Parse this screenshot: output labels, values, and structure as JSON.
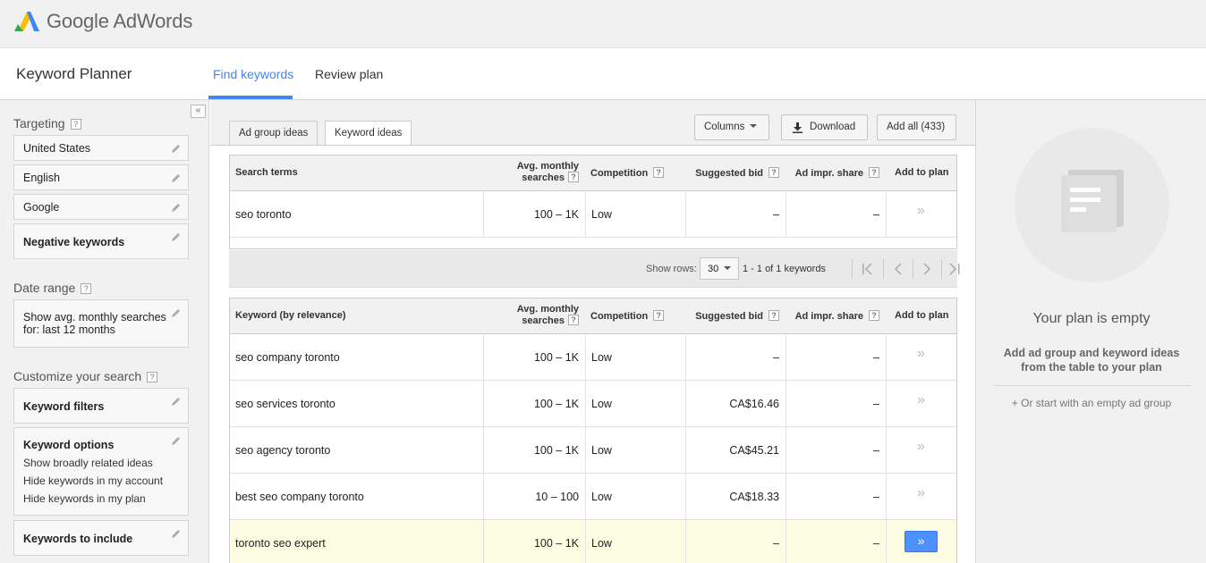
{
  "app": {
    "brand": "Google AdWords",
    "section_title": "Keyword Planner"
  },
  "header_tabs": [
    {
      "label": "Find keywords",
      "active": true
    },
    {
      "label": "Review plan",
      "active": false
    }
  ],
  "sidebar": {
    "collapse_label": "«",
    "targeting": {
      "title": "Targeting",
      "items": [
        "United States",
        "English",
        "Google",
        "Negative keywords"
      ]
    },
    "date_range": {
      "title": "Date range",
      "line1": "Show avg. monthly searches",
      "line2": "for: last 12 months"
    },
    "customize": {
      "title": "Customize your search",
      "keyword_filters": "Keyword filters",
      "keyword_options": {
        "title": "Keyword options",
        "lines": [
          "Show broadly related ideas",
          "Hide keywords in my account",
          "Hide keywords in my plan"
        ]
      },
      "keywords_to_include": "Keywords to include"
    },
    "help_mark": "?"
  },
  "toolbar": {
    "tab_adgroup": "Ad group ideas",
    "tab_keyword": "Keyword ideas",
    "columns": "Columns",
    "download": "Download",
    "add_all": "Add all (433)"
  },
  "search_table": {
    "headers": {
      "term": "Search terms",
      "avg1": "Avg. monthly",
      "avg2": "searches",
      "competition": "Competition",
      "bid": "Suggested bid",
      "impr": "Ad impr. share",
      "add": "Add to plan"
    },
    "rows": [
      {
        "keyword": "seo toronto",
        "searches": "100 – 1K",
        "competition": "Low",
        "bid": "–",
        "impr": "–",
        "add": "»"
      }
    ]
  },
  "pager": {
    "show_rows_label": "Show rows:",
    "rows_value": "30",
    "range_text": "1 - 1 of 1 keywords"
  },
  "keyword_table": {
    "headers": {
      "term": "Keyword (by relevance)",
      "avg1": "Avg. monthly",
      "avg2": "searches",
      "competition": "Competition",
      "bid": "Suggested bid",
      "impr": "Ad impr. share",
      "add": "Add to plan"
    },
    "rows": [
      {
        "keyword": "seo company toronto",
        "searches": "100 – 1K",
        "competition": "Low",
        "bid": "–",
        "impr": "–",
        "add": "»"
      },
      {
        "keyword": "seo services toronto",
        "searches": "100 – 1K",
        "competition": "Low",
        "bid": "CA$16.46",
        "impr": "–",
        "add": "»"
      },
      {
        "keyword": "seo agency toronto",
        "searches": "100 – 1K",
        "competition": "Low",
        "bid": "CA$45.21",
        "impr": "–",
        "add": "»"
      },
      {
        "keyword": "best seo company toronto",
        "searches": "10 – 100",
        "competition": "Low",
        "bid": "CA$18.33",
        "impr": "–",
        "add": "»"
      },
      {
        "keyword": "toronto seo expert",
        "searches": "100 – 1K",
        "competition": "Low",
        "bid": "–",
        "impr": "–",
        "add": "»"
      }
    ]
  },
  "plan": {
    "empty_title": "Your plan is empty",
    "desc_line1": "Add ad group and keyword ideas",
    "desc_line2": "from the table to your plan",
    "start_link": "+ Or start with an empty ad group"
  },
  "colors": {
    "accent": "#4285f4",
    "button_blue": "#4d90fe",
    "highlight_row": "#fdfde4"
  }
}
